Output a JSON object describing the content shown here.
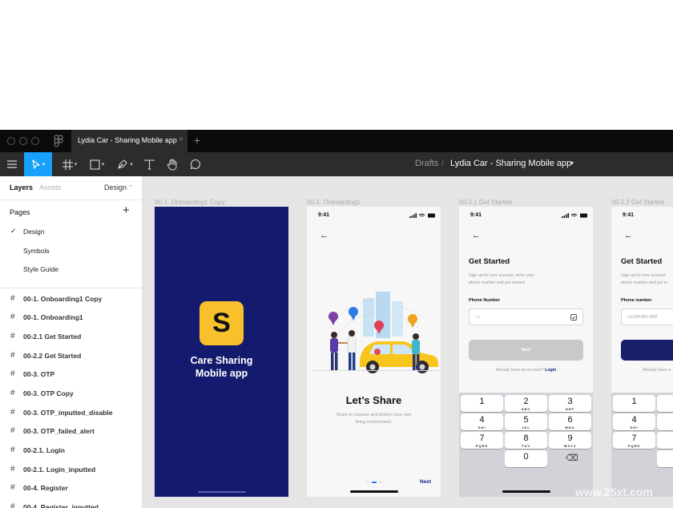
{
  "window": {
    "tab_title": "Lydia Car - Sharing Mobile app",
    "tab_close": "×",
    "tab_add": "+"
  },
  "toolbar": {
    "breadcrumb_drafts": "Drafts",
    "breadcrumb_sep": "/",
    "breadcrumb_file": "Lydia Car - Sharing Mobile app"
  },
  "left_panel": {
    "tabs": [
      "Layers",
      "Assets"
    ],
    "design_label": "Design",
    "pages_heading": "Pages",
    "pages": [
      {
        "label": "Design",
        "selected": true
      },
      {
        "label": "Symbols",
        "selected": false
      },
      {
        "label": "Style Guide",
        "selected": false
      }
    ],
    "layers": [
      "00-1. Onboarding1 Copy",
      "00-1. Onboarding1",
      "00-2.1 Get Started",
      "00-2.2 Get Started",
      "00-3. OTP",
      "00-3. OTP Copy",
      "00-3. OTP_inputted_disable",
      "00-3. OTP_failed_alert",
      "00-2.1. Login",
      "00-2.1. Login_inputted",
      "00-4. Register",
      "00-4. Register_inputted"
    ]
  },
  "canvas": {
    "frame_labels": [
      "00-1. Onboarding1 Copy",
      "00-1. Onboarding1",
      "00-2.1 Get Started",
      "00-2.2 Get Started"
    ],
    "splash": {
      "logo_letter": "S",
      "title_line1": "Care Sharing",
      "title_line2": "Mobile app"
    },
    "onboarding": {
      "time": "9:41",
      "title": "Let’s Share",
      "subtitle_line1": "Share to connect and protect your own",
      "subtitle_line2": "living environment.",
      "next": "Next"
    },
    "get_started": {
      "time": "9:41",
      "title": "Get Started",
      "desc_line1": "Sign up for new account, enter your",
      "desc_line2": "phone number and get started.",
      "phone_label": "Phone Number",
      "phone_value": "+1",
      "next_button": "Next",
      "login_prompt": "Already have an account?",
      "login_link": "Login"
    },
    "get_started_2": {
      "time": "9:41",
      "title": "Get Started",
      "desc_line1": "Sign up for new account",
      "desc_line2": "phone number and get st",
      "phone_label": "Phone number",
      "phone_placeholder": "+1234-567-890",
      "login_prompt": "Already have a"
    },
    "keypad": [
      {
        "d": "1",
        "l": ""
      },
      {
        "d": "2",
        "l": "ABC"
      },
      {
        "d": "3",
        "l": "DEF"
      },
      {
        "d": "4",
        "l": "GHI"
      },
      {
        "d": "5",
        "l": "JKL"
      },
      {
        "d": "6",
        "l": "MNO"
      },
      {
        "d": "7",
        "l": "PQRS"
      },
      {
        "d": "8",
        "l": "TUV"
      },
      {
        "d": "9",
        "l": "WXYZ"
      },
      {
        "d": "0",
        "l": ""
      }
    ],
    "keypad_partial": [
      {
        "d": "1",
        "l": ""
      },
      {
        "d": "4",
        "l": "GHI"
      },
      {
        "d": "7",
        "l": "PQRS"
      }
    ]
  },
  "watermark": "www.25xt.com",
  "colors": {
    "accent": "#18a0fb",
    "splash_bg": "#141b6e",
    "logo_yellow": "#f8c12c",
    "primary_navy": "#1a1f6c",
    "link": "#1a2378"
  }
}
